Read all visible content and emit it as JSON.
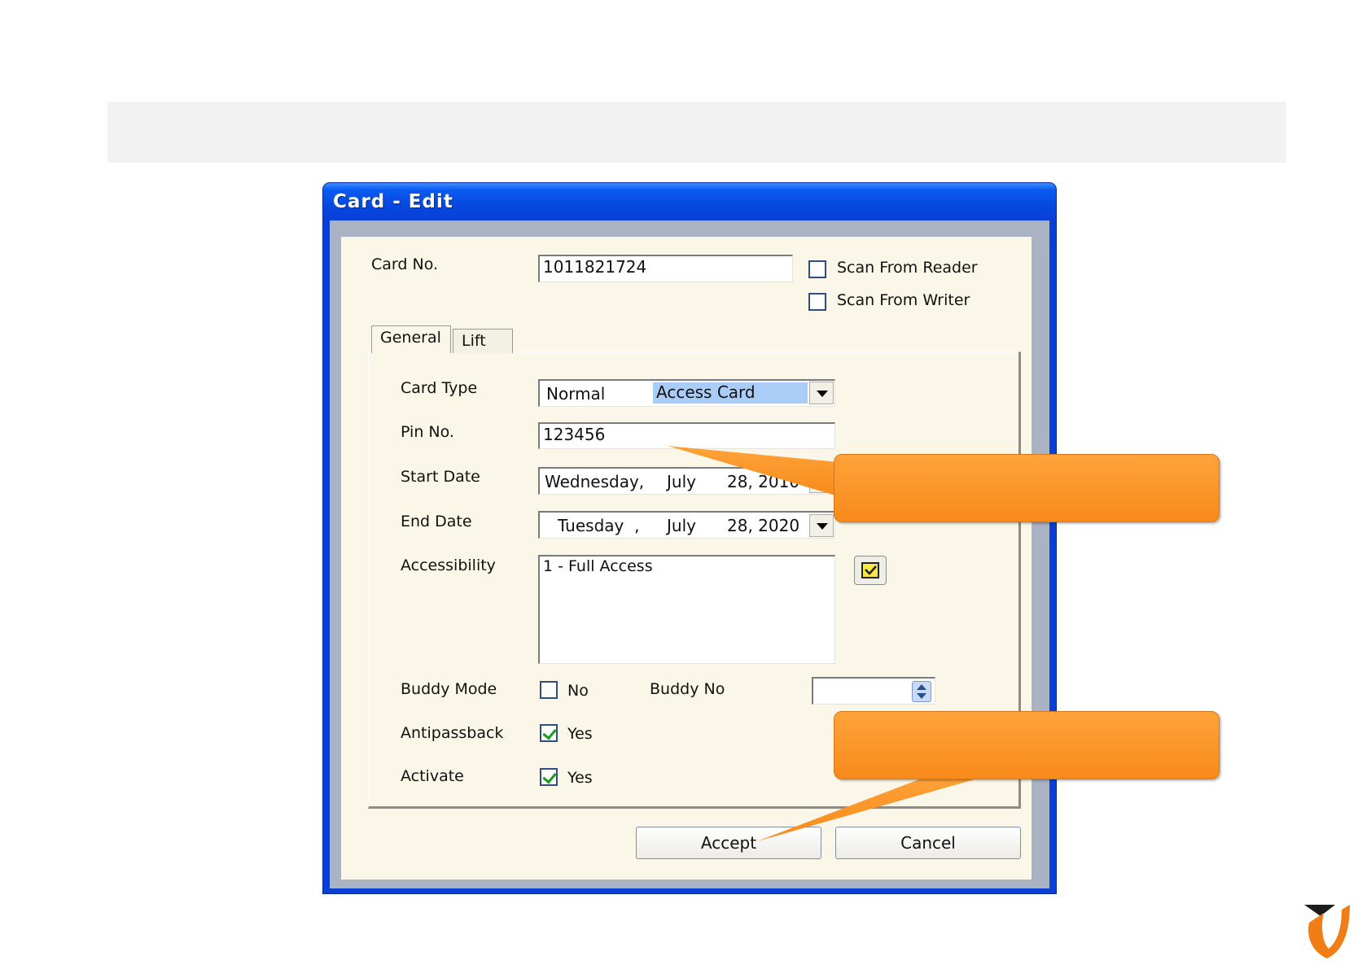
{
  "window": {
    "title": "Card - Edit"
  },
  "form": {
    "card_no_label": "Card No.",
    "card_no_value": "1011821724",
    "scan_from_reader_label": "Scan From Reader",
    "scan_from_writer_label": "Scan From Writer",
    "tabs": [
      {
        "label": "General",
        "selected": true
      },
      {
        "label": "Lift",
        "selected": false
      }
    ],
    "card_type_label": "Card Type",
    "card_type_value_prefix": "Normal",
    "card_type_value_selected": "Access Card",
    "pin_no_label": "Pin No.",
    "pin_no_value": "123456",
    "start_date_label": "Start Date",
    "start_date": {
      "day": "Wednesday,",
      "month": "July",
      "date": "28, 2010"
    },
    "end_date_label": "End Date",
    "end_date": {
      "day": "Tuesday  ,",
      "month": "July",
      "date": "28, 2020"
    },
    "accessibility_label": "Accessibility",
    "accessibility_value": "1 - Full Access",
    "buddy_mode_label": "Buddy Mode",
    "buddy_mode_value": "No",
    "buddy_no_label": "Buddy No",
    "antipassback_label": "Antipassback",
    "antipassback_value": "Yes",
    "activate_label": "Activate",
    "activate_value": "Yes"
  },
  "buttons": {
    "accept": "Accept",
    "cancel": "Cancel"
  },
  "colors": {
    "title_blue": "#0a3fd6",
    "callout_orange": "#f78a1a",
    "selection_blue": "#a9cdf7"
  },
  "icons": [
    "accessibility-picker-icon",
    "spinner-arrows-icon",
    "dropdown-arrow-icon",
    "brand-shield-logo"
  ]
}
